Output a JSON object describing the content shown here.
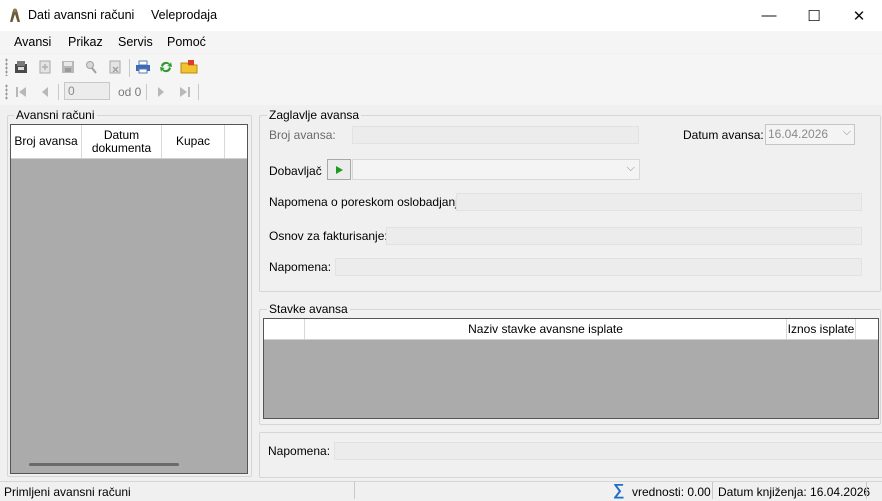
{
  "window": {
    "title": "Dati avansni računi",
    "subtitle": "Veleprodaja",
    "minimize_glyph": "—",
    "maximize_glyph": "☐",
    "close_glyph": "✕"
  },
  "menu": [
    "Avansi",
    "Prikaz",
    "Servis",
    "Pomoć"
  ],
  "toolbar": {
    "icons": [
      "new-record-icon",
      "add-icon",
      "save-icon",
      "search-icon",
      "delete-icon",
      "print-icon",
      "refresh-icon",
      "open-folder-icon"
    ]
  },
  "navigator": {
    "position_value": "0",
    "of_label": "od 0"
  },
  "list_panel": {
    "title": "Avansni računi",
    "columns": [
      "Broj avansa",
      "Datum dokumenta",
      "Kupac"
    ]
  },
  "header_panel": {
    "title": "Zaglavlje avansa",
    "broj_label": "Broj avansa:",
    "datum_label": "Datum avansa:",
    "datum_value": "16.04.2026",
    "dobavljac_label": "Dobavljač",
    "napomena_poresko_label": "Napomena o poreskom oslobadjanju:",
    "osnov_label": "Osnov za fakturisanje:",
    "napomena_label": "Napomena:"
  },
  "items_panel": {
    "title": "Stavke avansa",
    "columns": [
      "Naziv stavke avansne isplate",
      "Iznos isplate"
    ]
  },
  "bottom": {
    "napomena_label": "Napomena:"
  },
  "statusbar": {
    "left": "Primljeni avansni računi",
    "vrednosti": "vrednosti: 0.00",
    "datum": "Datum knjiženja: 16.04.2026",
    "sigma": "∑"
  },
  "colors": {
    "grid_bg": "#ababab",
    "accent_blue": "#1e6fc5"
  }
}
